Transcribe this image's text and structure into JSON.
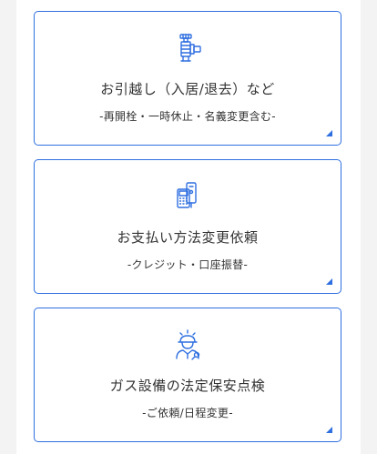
{
  "cards": [
    {
      "title": "お引越し（入居/退去）など",
      "subtitle": "-再開栓・一時休止・名義変更含む-",
      "icon": "faucet-icon"
    },
    {
      "title": "お支払い方法変更依頼",
      "subtitle": "-クレジット・口座振替-",
      "icon": "payment-terminal-icon"
    },
    {
      "title": "ガス設備の法定保安点検",
      "subtitle": "-ご依頼/日程変更-",
      "icon": "worker-icon"
    }
  ],
  "colors": {
    "accent": "#2f6fe0",
    "text": "#333333",
    "page_background": "#f3f3f3"
  }
}
